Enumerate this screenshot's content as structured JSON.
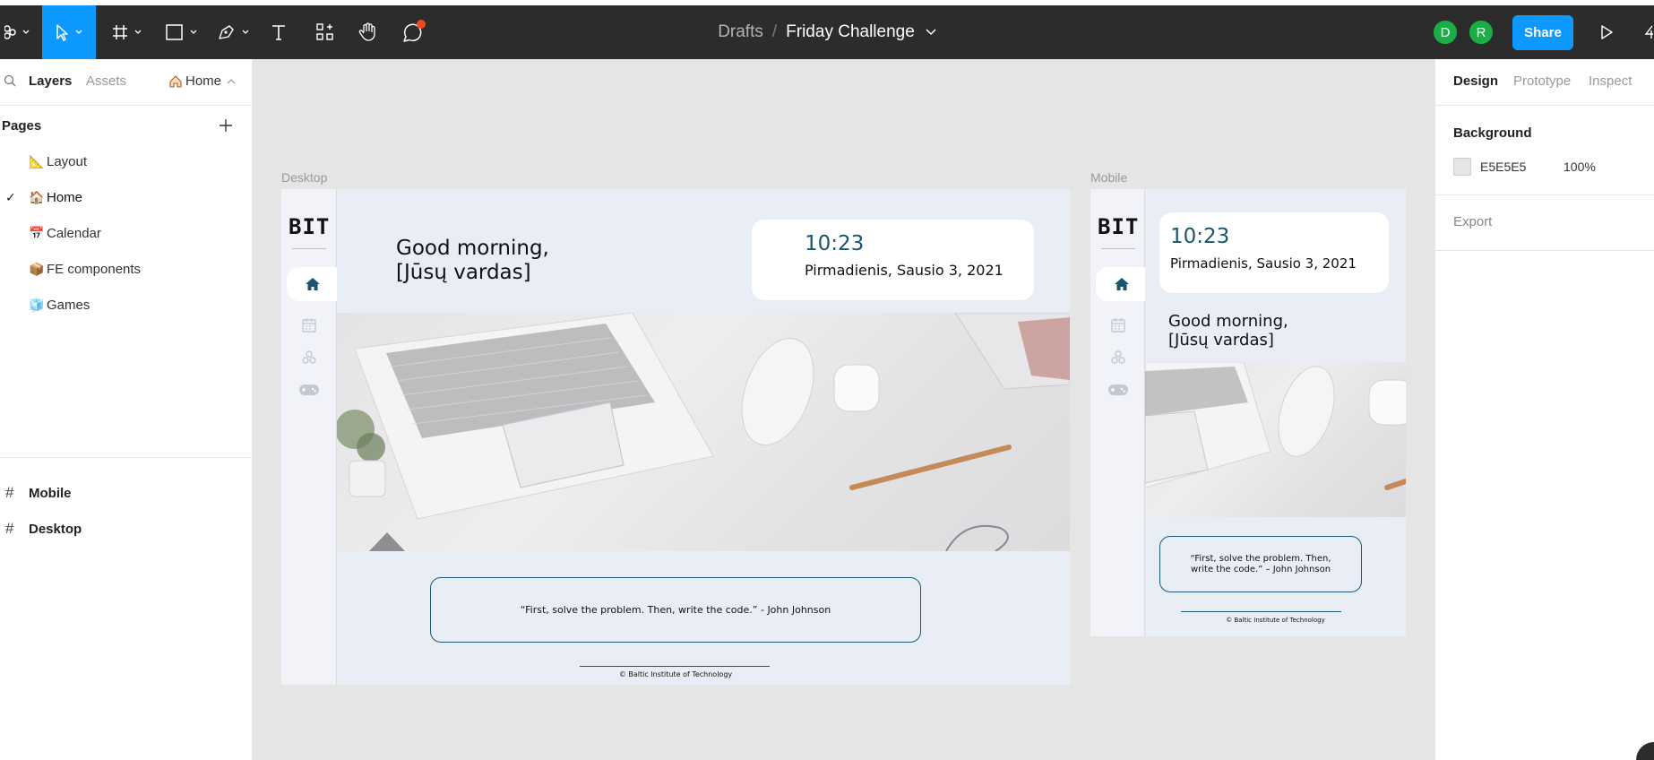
{
  "toolbar": {
    "breadcrumb_drafts": "Drafts",
    "breadcrumb_separator": "/",
    "file_name": "Friday Challenge",
    "avatars": [
      "D",
      "R"
    ],
    "share_label": "Share",
    "accent": "#0d99ff",
    "notification_color": "#f24822"
  },
  "left_panel": {
    "tabs": {
      "layers": "Layers",
      "assets": "Assets",
      "current_page": "Home"
    },
    "pages_header": "Pages",
    "pages": [
      {
        "emoji": "📐",
        "label": "Layout"
      },
      {
        "emoji": "🏠",
        "label": "Home",
        "selected": true
      },
      {
        "emoji": "📅",
        "label": "Calendar"
      },
      {
        "emoji": "📦",
        "label": "FE components"
      },
      {
        "emoji": "🧊",
        "label": "Games"
      }
    ],
    "layers": [
      "Mobile",
      "Desktop"
    ]
  },
  "canvas": {
    "background": "#e5e5e5",
    "desktop": {
      "label": "Desktop",
      "logo": "BIT",
      "greeting_line1": "Good morning,",
      "greeting_line2": "[Jūsų vardas]",
      "time": "10:23",
      "date": "Pirmadienis, Sausio 3, 2021",
      "quote": "“First, solve the problem. Then, write the code.” - John Johnson",
      "footer": "© Baltic Institute of Technology"
    },
    "mobile": {
      "label": "Mobile",
      "logo": "BIT",
      "time": "10:23",
      "date": "Pirmadienis, Sausio 3, 2021",
      "greeting_line1": "Good morning,",
      "greeting_line2": "[Jūsų vardas]",
      "quote": "“First, solve the problem. Then, write the code.” – John Johnson",
      "footer": "© Baltic Institute of Technology"
    }
  },
  "right_panel": {
    "tabs": [
      "Design",
      "Prototype",
      "Inspect"
    ],
    "background_title": "Background",
    "background_hex": "E5E5E5",
    "background_opacity": "100%",
    "export_label": "Export"
  }
}
